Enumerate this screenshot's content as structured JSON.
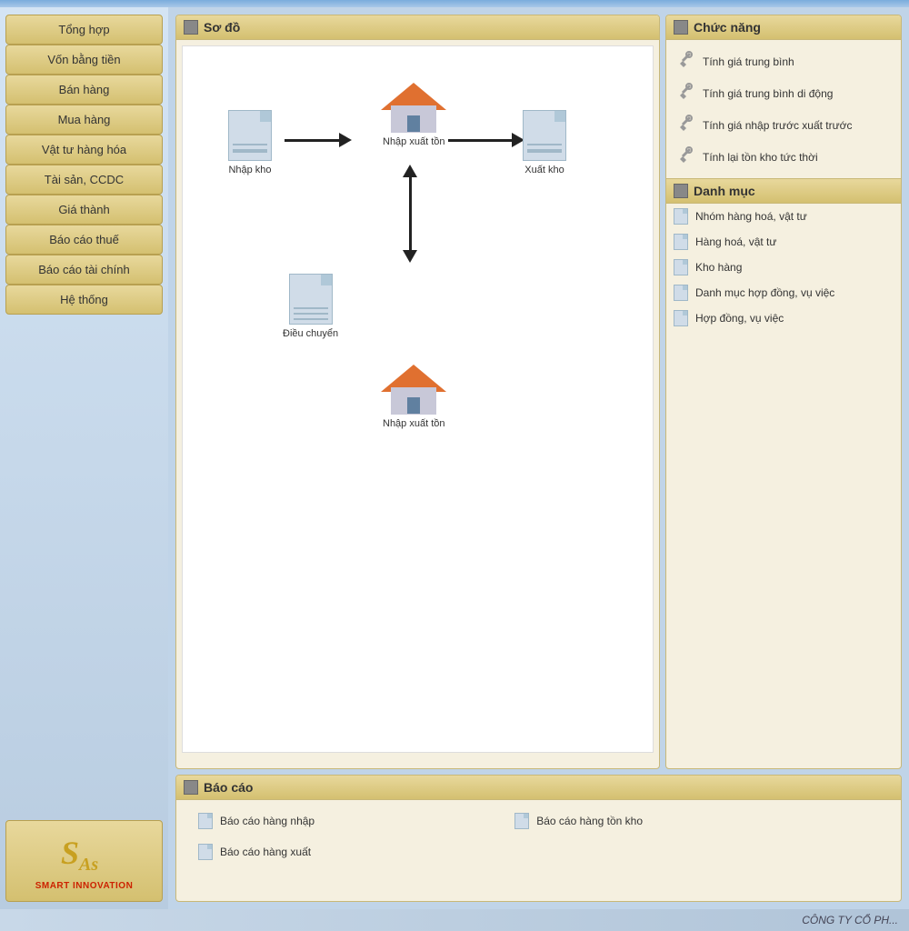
{
  "sidebar": {
    "items": [
      {
        "label": "Tổng hợp",
        "name": "tong-hop"
      },
      {
        "label": "Vốn bằng tiền",
        "name": "von-bang-tien"
      },
      {
        "label": "Bán hàng",
        "name": "ban-hang"
      },
      {
        "label": "Mua hàng",
        "name": "mua-hang"
      },
      {
        "label": "Vật tư hàng hóa",
        "name": "vat-tu-hang-hoa"
      },
      {
        "label": "Tài sản, CCDC",
        "name": "tai-san-ccdc"
      },
      {
        "label": "Giá thành",
        "name": "gia-thanh"
      },
      {
        "label": "Báo cáo thuế",
        "name": "bao-cao-thue"
      },
      {
        "label": "Báo cáo tài chính",
        "name": "bao-cao-tai-chinh"
      },
      {
        "label": "Hệ thống",
        "name": "he-thong"
      }
    ],
    "logo_name": "SMART INNOVATION"
  },
  "sodo": {
    "title": "Sơ đồ",
    "nodes": {
      "nhap_kho": "Nhập kho",
      "nhap_xuat_ton_top": "Nhập xuất tồn",
      "xuat_kho": "Xuất kho",
      "dieu_chuyen": "Điều chuyển",
      "nhap_xuat_ton_bottom": "Nhập xuất tồn"
    }
  },
  "chuc_nang": {
    "title": "Chức năng",
    "items": [
      "Tính giá trung bình",
      "Tính giá trung bình di động",
      "Tính giá nhập trước xuất trước",
      "Tính lại tồn kho tức thời"
    ]
  },
  "danh_muc": {
    "title": "Danh mục",
    "items": [
      "Nhóm hàng hoá, vật tư",
      "Hàng hoá, vật tư",
      "Kho hàng",
      "Danh mục hợp đồng, vụ việc",
      "Hợp đồng, vụ việc"
    ]
  },
  "bao_cao": {
    "title": "Báo cáo",
    "items": [
      "Báo cáo hàng nhập",
      "Báo cáo hàng tồn kho",
      "Báo cáo hàng xuất"
    ]
  },
  "bottom_bar": {
    "company": "CÔNG TY CỔ PH..."
  }
}
